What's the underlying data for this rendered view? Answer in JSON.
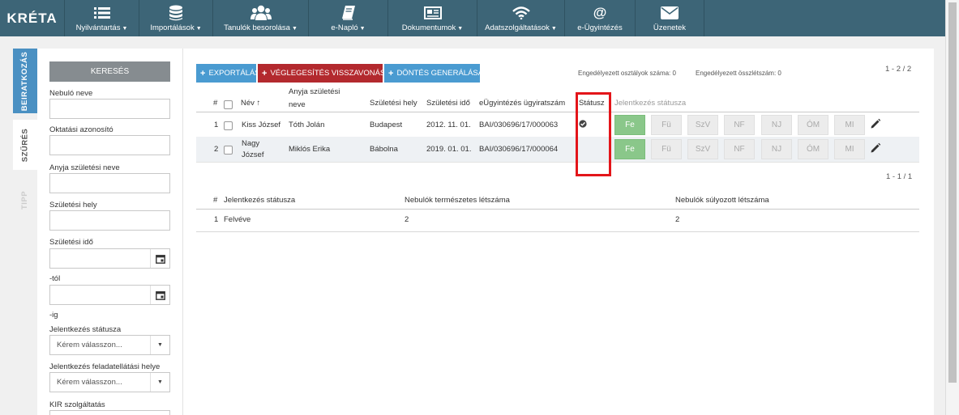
{
  "app": {
    "logo": "KRÉTA"
  },
  "nav": [
    {
      "label": "Nyilvántartás",
      "icon": "list-icon",
      "caret": "▼"
    },
    {
      "label": "Importálások",
      "icon": "database-icon",
      "caret": "▼"
    },
    {
      "label": "Tanulók besorolása",
      "icon": "users-icon",
      "caret": "▼"
    },
    {
      "label": "e-Napló",
      "icon": "book-icon",
      "caret": "▼"
    },
    {
      "label": "Dokumentumok",
      "icon": "newspaper-icon",
      "caret": "▼"
    },
    {
      "label": "Adatszolgáltatások",
      "icon": "wifi-icon",
      "caret": "▼"
    },
    {
      "label": "e-Ügyintézés",
      "icon": "at-icon",
      "caret": ""
    },
    {
      "label": "Üzenetek",
      "icon": "envelope-icon",
      "caret": ""
    }
  ],
  "side_tabs": {
    "beiratkozas": "BEIRATKOZÁS",
    "szures": "SZŰRÉS",
    "tipp": "TIPP"
  },
  "filter": {
    "search_button": "KERESÉS",
    "nebulo_neve": "Nebuló neve",
    "oktatasi_azonosito": "Oktatási azonosító",
    "anyja_szuletesi_neve": "Anyja születési neve",
    "szuletesi_hely": "Születési hely",
    "szuletesi_ido": "Születési idő",
    "tol": "-tól",
    "ig": "-ig",
    "jelentkezes_statusza": "Jelentkezés státusza",
    "jelentkezes_statusza_value": "Kérem válasszon...",
    "feladatellatasi_hely": "Jelentkezés feladatellátási helye",
    "feladatellatasi_hely_value": "Kérem válasszon...",
    "kir_szolgaltatas": "KIR szolgáltatás"
  },
  "toolbar": {
    "export": "EXPORTÁLÁS",
    "veglegesites": "VÉGLEGESÍTÉS VISSZAVONÁSA",
    "dontes": "DÖNTÉS GENERÁLÁSA",
    "engedelyezett_osztalyok": "Engedélyezett osztályok száma: 0",
    "engedelyezett_osszletszam": "Engedélyezett összlétszám: 0",
    "pager_top": "1 - 2 / 2"
  },
  "table": {
    "headers": {
      "num": "#",
      "nev": "Név",
      "sort": "↑",
      "anyja_line1": "Anyja születési",
      "anyja_line2": "neve",
      "szuletesi_hely": "Születési hely",
      "szuletesi_ido": "Születési idő",
      "ugyiratszam": "eÜgyintézés ügyiratszám",
      "statusz": "Státusz",
      "jelentkezes_statusza": "Jelentkezés státusza"
    },
    "status_buttons": [
      "Fe",
      "Fü",
      "SzV",
      "NF",
      "NJ",
      "ÓM",
      "MI"
    ],
    "rows": [
      {
        "num": "1",
        "nev_line1": "Kiss József",
        "nev_line2": "",
        "anyja": "Tóth Jolán",
        "hely": "Budapest",
        "ido": "2012. 11. 01.",
        "ugyiratszam": "BAI/030696/17/000063",
        "statusz_icon": "check-circle-icon"
      },
      {
        "num": "2",
        "nev_line1": "Nagy",
        "nev_line2": "József",
        "anyja": "Miklós Erika",
        "hely": "Bábolna",
        "ido": "2019. 01. 01.",
        "ugyiratszam": "BAI/030696/17/000064",
        "statusz_icon": ""
      }
    ]
  },
  "summary": {
    "pager": "1 - 1 / 1",
    "headers": {
      "num": "#",
      "jelentkezes_statusza": "Jelentkezés státusza",
      "termeszetes": "Nebulók természetes létszáma",
      "sulyozott": "Nebulók súlyozott létszáma"
    },
    "rows": [
      {
        "num": "1",
        "statusz": "Felvéve",
        "termeszetes": "2",
        "sulyozott": "2"
      }
    ]
  },
  "colors": {
    "nav": "#3d6577",
    "accent_blue": "#4a9bd1",
    "danger": "#b3292e",
    "active_green": "#8ac78a",
    "highlight": "#e3151a"
  }
}
